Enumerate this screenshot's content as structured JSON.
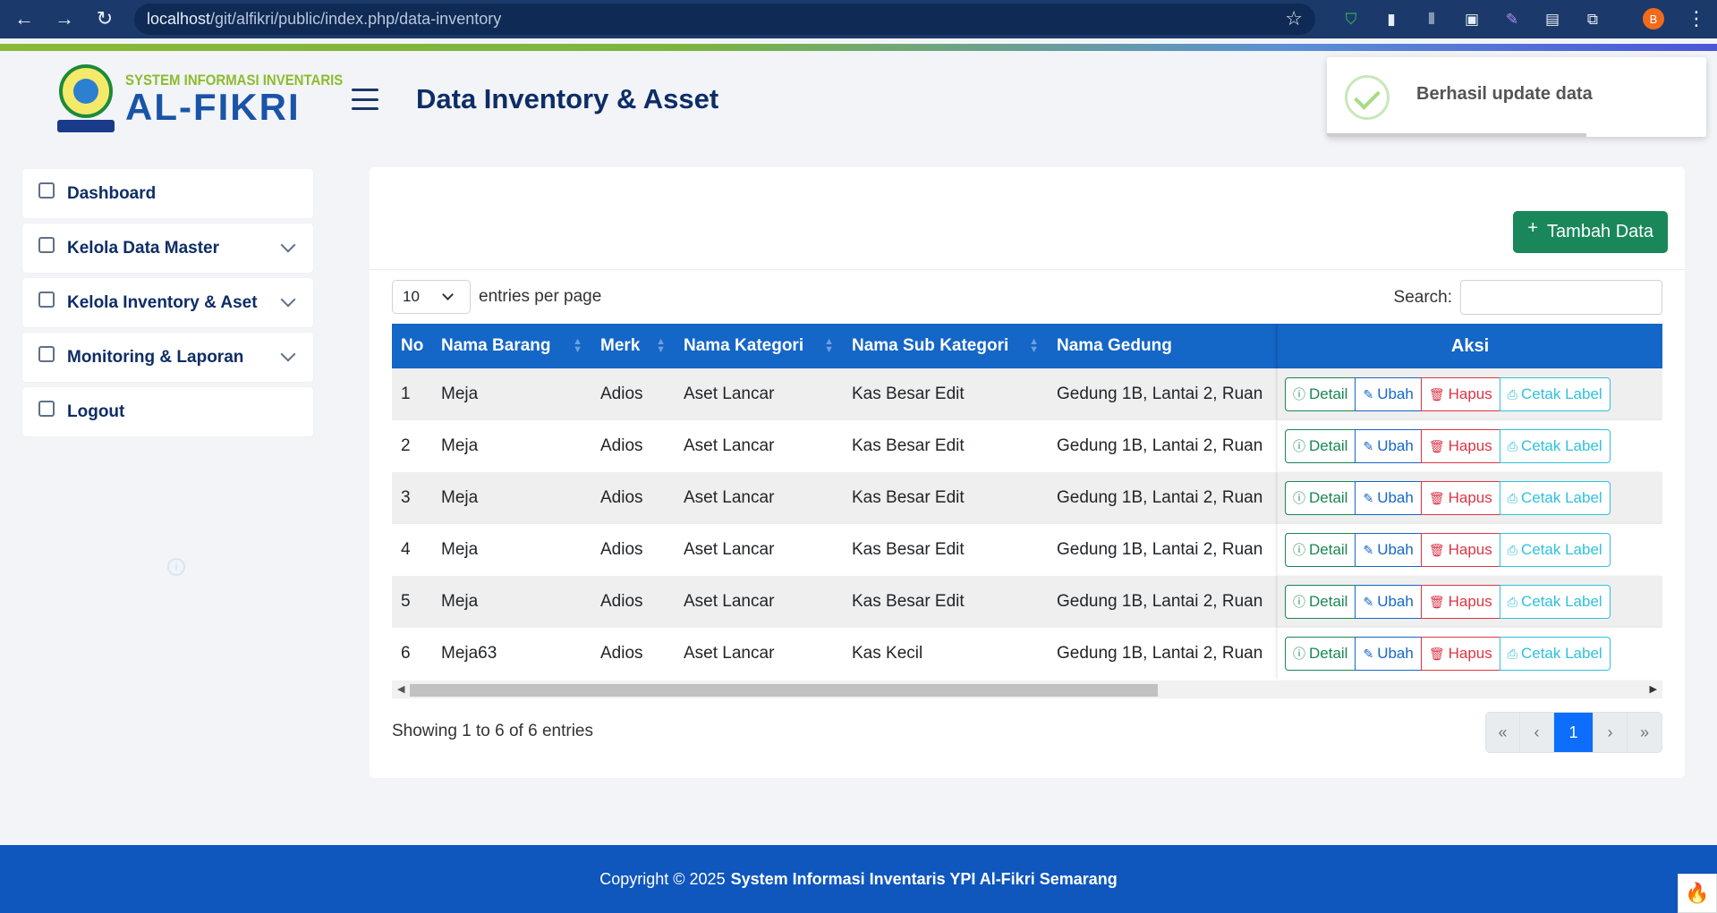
{
  "browser": {
    "url_host": "localhost",
    "url_path": "/git/alfikri/public/index.php/data-inventory",
    "profile_initial": "B"
  },
  "brand": {
    "subtitle": "SYSTEM INFORMASI INVENTARIS",
    "name": "AL-FIKRI"
  },
  "page_title": "Data Inventory & Asset",
  "toast": {
    "message": "Berhasil update data"
  },
  "sidebar": {
    "items": [
      {
        "label": "Dashboard",
        "icon": "home-icon",
        "expandable": false
      },
      {
        "label": "Kelola Data Master",
        "icon": "database-icon",
        "expandable": true
      },
      {
        "label": "Kelola Inventory & Aset",
        "icon": "document-icon",
        "expandable": true
      },
      {
        "label": "Monitoring & Laporan",
        "icon": "copy-icon",
        "expandable": true
      },
      {
        "label": "Logout",
        "icon": "logout-icon",
        "expandable": false
      }
    ]
  },
  "toolbar": {
    "add_label": "Tambah Data"
  },
  "table_controls": {
    "page_length": "10",
    "length_label": "entries per page",
    "search_label": "Search:",
    "search_value": ""
  },
  "table": {
    "columns": [
      "No",
      "Nama Barang",
      "Merk",
      "Nama Kategori",
      "Nama Sub Kategori",
      "Nama Gedung"
    ],
    "action_column": "Aksi",
    "rows": [
      [
        "1",
        "Meja",
        "Adios",
        "Aset Lancar",
        "Kas Besar Edit",
        "Gedung 1B, Lantai 2, Ruan"
      ],
      [
        "2",
        "Meja",
        "Adios",
        "Aset Lancar",
        "Kas Besar Edit",
        "Gedung 1B, Lantai 2, Ruan"
      ],
      [
        "3",
        "Meja",
        "Adios",
        "Aset Lancar",
        "Kas Besar Edit",
        "Gedung 1B, Lantai 2, Ruan"
      ],
      [
        "4",
        "Meja",
        "Adios",
        "Aset Lancar",
        "Kas Besar Edit",
        "Gedung 1B, Lantai 2, Ruan"
      ],
      [
        "5",
        "Meja",
        "Adios",
        "Aset Lancar",
        "Kas Besar Edit",
        "Gedung 1B, Lantai 2, Ruan"
      ],
      [
        "6",
        "Meja63",
        "Adios",
        "Aset Lancar",
        "Kas Kecil",
        "Gedung 1B, Lantai 2, Ruan"
      ]
    ],
    "actions": {
      "detail": "Detail",
      "edit": "Ubah",
      "delete": "Hapus",
      "print": "Cetak Label"
    }
  },
  "table_info": "Showing 1 to 6 of 6 entries",
  "pagination": {
    "first": "«",
    "prev": "‹",
    "current": "1",
    "next": "›",
    "last": "»"
  },
  "footer": {
    "prefix": "Copyright © 2025",
    "org": "System Informasi Inventaris YPI Al-Fikri Semarang"
  },
  "colors": {
    "primary": "#1466c7",
    "success": "#19875a",
    "danger": "#dc3545",
    "info": "#2fc1dc",
    "navy": "#0d2d66"
  }
}
